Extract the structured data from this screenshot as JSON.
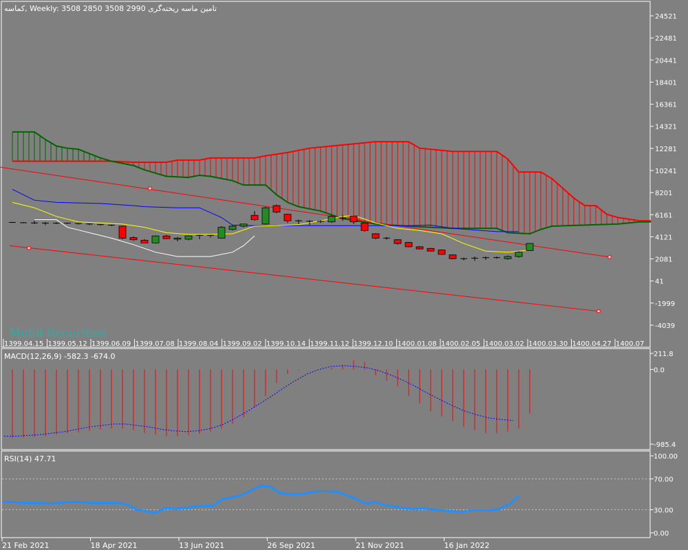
{
  "header": {
    "symbol": "کماسه",
    "timeframe": "Weekly:",
    "ohlc": "3508 2850 3508 2990",
    "company": "تامین ماسه ریخته‌گری"
  },
  "watermark": "Mofid Securities",
  "colors": {
    "background": "#808080",
    "grid": "#ffffff",
    "bull": "#228b22",
    "bear": "#ff0000",
    "cloud_a": "#ff0000",
    "cloud_b": "#006400",
    "tenkan": "#ffff00",
    "kijun": "#0000ff",
    "chikou": "#ffffff",
    "channel": "#ff0000",
    "macd_hist": "#ff0000",
    "macd_signal": "#0000ff",
    "rsi": "#1e90ff"
  },
  "chart_data": [
    {
      "type": "candlestick",
      "y_ticks": [
        "24521",
        "22481",
        "20441",
        "18401",
        "16361",
        "14321",
        "12281",
        "10241",
        "8201",
        "6161",
        "4121",
        "2081",
        "41",
        "-1999",
        "-4039"
      ],
      "ylim": [
        -5000,
        25500
      ],
      "x_ticks": [
        "1399.04.15",
        "1399.05.12",
        "1399.06.09",
        "1399.07.08",
        "1399.08.04",
        "1399.09.02",
        "1399.10.14",
        "1399.11.12",
        "1399.12.10",
        "1400.01.08",
        "1400.02.05",
        "1400.03.02",
        "1400.03.30",
        "1400.04.27",
        "1400.07"
      ],
      "candles": [
        {
          "o": 5450,
          "h": 5500,
          "l": 5400,
          "c": 5450
        },
        {
          "o": 5420,
          "h": 5480,
          "l": 5380,
          "c": 5420
        },
        {
          "o": 5400,
          "h": 5600,
          "l": 5300,
          "c": 5350
        },
        {
          "o": 5300,
          "h": 5500,
          "l": 5200,
          "c": 5380
        },
        {
          "o": 5380,
          "h": 5450,
          "l": 5300,
          "c": 5380
        },
        {
          "o": 5380,
          "h": 5420,
          "l": 5300,
          "c": 5350
        },
        {
          "o": 5350,
          "h": 5400,
          "l": 5250,
          "c": 5300
        },
        {
          "o": 5300,
          "h": 5350,
          "l": 5200,
          "c": 5250
        },
        {
          "o": 5250,
          "h": 5300,
          "l": 5150,
          "c": 5200
        },
        {
          "o": 5200,
          "h": 5250,
          "l": 5100,
          "c": 5150
        },
        {
          "o": 5100,
          "h": 5150,
          "l": 3900,
          "c": 4000
        },
        {
          "o": 4050,
          "h": 4150,
          "l": 3750,
          "c": 3850
        },
        {
          "o": 3800,
          "h": 3900,
          "l": 3500,
          "c": 3550
        },
        {
          "o": 3550,
          "h": 4250,
          "l": 3500,
          "c": 4200
        },
        {
          "o": 4200,
          "h": 4300,
          "l": 3900,
          "c": 3950
        },
        {
          "o": 3900,
          "h": 4100,
          "l": 3700,
          "c": 4000
        },
        {
          "o": 3900,
          "h": 4250,
          "l": 3800,
          "c": 4200
        },
        {
          "o": 4200,
          "h": 4300,
          "l": 3900,
          "c": 4250
        },
        {
          "o": 4250,
          "h": 4300,
          "l": 4050,
          "c": 4200
        },
        {
          "o": 4000,
          "h": 5100,
          "l": 3950,
          "c": 5000
        },
        {
          "o": 4800,
          "h": 5200,
          "l": 4700,
          "c": 5100
        },
        {
          "o": 5100,
          "h": 5300,
          "l": 5000,
          "c": 5300
        },
        {
          "o": 6100,
          "h": 6500,
          "l": 5600,
          "c": 5700
        },
        {
          "o": 5300,
          "h": 6900,
          "l": 5250,
          "c": 6800
        },
        {
          "o": 7000,
          "h": 7100,
          "l": 6300,
          "c": 6400
        },
        {
          "o": 6200,
          "h": 6250,
          "l": 5400,
          "c": 5600
        },
        {
          "o": 5600,
          "h": 5700,
          "l": 5300,
          "c": 5550
        },
        {
          "o": 5550,
          "h": 5650,
          "l": 5200,
          "c": 5500
        },
        {
          "o": 5550,
          "h": 5650,
          "l": 5400,
          "c": 5550
        },
        {
          "o": 5500,
          "h": 6100,
          "l": 5400,
          "c": 6000
        },
        {
          "o": 5850,
          "h": 6150,
          "l": 5600,
          "c": 5850
        },
        {
          "o": 6050,
          "h": 6150,
          "l": 5300,
          "c": 5500
        },
        {
          "o": 5400,
          "h": 5450,
          "l": 4600,
          "c": 4700
        },
        {
          "o": 4400,
          "h": 4450,
          "l": 3900,
          "c": 4000
        },
        {
          "o": 4000,
          "h": 4100,
          "l": 3850,
          "c": 3950
        },
        {
          "o": 3850,
          "h": 3900,
          "l": 3400,
          "c": 3500
        },
        {
          "o": 3600,
          "h": 3650,
          "l": 3150,
          "c": 3200
        },
        {
          "o": 3200,
          "h": 3250,
          "l": 2950,
          "c": 3000
        },
        {
          "o": 3050,
          "h": 3100,
          "l": 2750,
          "c": 2800
        },
        {
          "o": 2900,
          "h": 2950,
          "l": 2450,
          "c": 2500
        },
        {
          "o": 2450,
          "h": 2500,
          "l": 2050,
          "c": 2100
        },
        {
          "o": 2100,
          "h": 2200,
          "l": 1950,
          "c": 2050
        },
        {
          "o": 2100,
          "h": 2300,
          "l": 1900,
          "c": 2150
        },
        {
          "o": 2150,
          "h": 2300,
          "l": 2000,
          "c": 2200
        },
        {
          "o": 2200,
          "h": 2300,
          "l": 2100,
          "c": 2200
        },
        {
          "o": 2100,
          "h": 2400,
          "l": 2000,
          "c": 2300
        },
        {
          "o": 2300,
          "h": 2800,
          "l": 2200,
          "c": 2700
        },
        {
          "o": 2850,
          "h": 3508,
          "l": 2850,
          "c": 3508
        }
      ],
      "tenkan": [
        [
          0,
          7300
        ],
        [
          2,
          6800
        ],
        [
          4,
          6000
        ],
        [
          6,
          5500
        ],
        [
          8,
          5400
        ],
        [
          10,
          5300
        ],
        [
          12,
          5000
        ],
        [
          14,
          4500
        ],
        [
          16,
          4350
        ],
        [
          18,
          4350
        ],
        [
          20,
          4400
        ],
        [
          22,
          5100
        ],
        [
          24,
          5150
        ],
        [
          26,
          5250
        ],
        [
          28,
          5600
        ],
        [
          30,
          6000
        ],
        [
          31,
          6100
        ],
        [
          33,
          5400
        ],
        [
          35,
          4900
        ],
        [
          37,
          4700
        ],
        [
          39,
          4400
        ],
        [
          41,
          3500
        ],
        [
          43,
          2800
        ],
        [
          45,
          2700
        ],
        [
          47,
          2900
        ]
      ],
      "kijun": [
        [
          0,
          8500
        ],
        [
          2,
          7500
        ],
        [
          4,
          7300
        ],
        [
          8,
          7200
        ],
        [
          11,
          7000
        ],
        [
          12,
          6900
        ],
        [
          15,
          6800
        ],
        [
          17,
          6800
        ],
        [
          19,
          5900
        ],
        [
          20,
          5200
        ],
        [
          22,
          5150
        ],
        [
          30,
          5150
        ],
        [
          33,
          5150
        ],
        [
          36,
          5150
        ],
        [
          38,
          5200
        ],
        [
          40,
          4900
        ],
        [
          44,
          4600
        ],
        [
          46,
          4600
        ]
      ],
      "chikou": [
        [
          2,
          5700
        ],
        [
          4,
          5700
        ],
        [
          5,
          5000
        ],
        [
          7,
          4500
        ],
        [
          9,
          4000
        ],
        [
          11,
          3400
        ],
        [
          13,
          2700
        ],
        [
          15,
          2300
        ],
        [
          18,
          2300
        ],
        [
          20,
          2700
        ],
        [
          21,
          3300
        ],
        [
          22,
          4200
        ]
      ],
      "span_a": [
        [
          0,
          11100
        ],
        [
          9,
          11100
        ],
        [
          11,
          11000
        ],
        [
          14,
          11000
        ],
        [
          15,
          11200
        ],
        [
          16,
          11200
        ],
        [
          17,
          11200
        ],
        [
          18,
          11400
        ],
        [
          22,
          11400
        ],
        [
          23,
          11600
        ],
        [
          25,
          11900
        ],
        [
          27,
          12300
        ],
        [
          29,
          12500
        ],
        [
          31,
          12700
        ],
        [
          33,
          12900
        ],
        [
          36,
          12900
        ],
        [
          37,
          12300
        ],
        [
          40,
          12000
        ],
        [
          44,
          12000
        ],
        [
          45,
          11300
        ],
        [
          46,
          10100
        ],
        [
          48,
          10100
        ],
        [
          49,
          9500
        ],
        [
          51,
          7700
        ],
        [
          52,
          7000
        ],
        [
          53,
          7000
        ],
        [
          54,
          6200
        ],
        [
          55,
          5900
        ],
        [
          57,
          5600
        ],
        [
          58,
          5600
        ]
      ],
      "span_b": [
        [
          0,
          13800
        ],
        [
          1,
          13800
        ],
        [
          2,
          13800
        ],
        [
          3,
          13100
        ],
        [
          4,
          12500
        ],
        [
          5,
          12300
        ],
        [
          6,
          12200
        ],
        [
          7,
          11800
        ],
        [
          8,
          11400
        ],
        [
          9,
          11100
        ],
        [
          11,
          10700
        ],
        [
          12,
          10300
        ],
        [
          13,
          10000
        ],
        [
          14,
          9700
        ],
        [
          16,
          9600
        ],
        [
          17,
          9800
        ],
        [
          18,
          9700
        ],
        [
          20,
          9300
        ],
        [
          21,
          8900
        ],
        [
          23,
          8900
        ],
        [
          24,
          8000
        ],
        [
          25,
          7300
        ],
        [
          26,
          6900
        ],
        [
          28,
          6500
        ],
        [
          30,
          5800
        ],
        [
          33,
          5300
        ],
        [
          36,
          5100
        ],
        [
          38,
          5000
        ],
        [
          40,
          4900
        ],
        [
          44,
          4900
        ],
        [
          45,
          4500
        ],
        [
          47,
          4400
        ],
        [
          48,
          4800
        ],
        [
          49,
          5100
        ],
        [
          52,
          5200
        ],
        [
          55,
          5300
        ],
        [
          57,
          5500
        ],
        [
          58,
          5500
        ]
      ],
      "channel": [
        {
          "from": [
            0,
            10550
          ],
          "to": [
            55,
            2250
          ]
        },
        {
          "from": [
            0,
            3300
          ],
          "to": [
            54,
            -2750
          ]
        }
      ]
    },
    {
      "type": "bar",
      "title": "MACD(12,26,9) -582.3 -674.0",
      "y_ticks": [
        "211.8",
        "0.0",
        "-985.4"
      ],
      "ylim": [
        -985.4,
        211.8
      ],
      "histogram": [
        -900,
        -900,
        -890,
        -880,
        -860,
        -840,
        -830,
        -810,
        -790,
        -780,
        -780,
        -800,
        -840,
        -860,
        -880,
        -880,
        -870,
        -850,
        -820,
        -780,
        -720,
        -630,
        -500,
        -350,
        -180,
        -60,
        -10,
        0,
        0,
        20,
        60,
        120,
        100,
        -80,
        -150,
        -220,
        -350,
        -450,
        -550,
        -620,
        -680,
        -760,
        -800,
        -840,
        -840,
        -820,
        -780,
        -582.3
      ],
      "signal": [
        -880,
        -880,
        -870,
        -860,
        -840,
        -820,
        -790,
        -760,
        -740,
        -720,
        -720,
        -740,
        -760,
        -790,
        -810,
        -820,
        -810,
        -780,
        -730,
        -650,
        -560,
        -460,
        -360,
        -250,
        -150,
        -60,
        0,
        40,
        50,
        40,
        20,
        -20,
        -80,
        -150,
        -230,
        -320,
        -400,
        -480,
        -550,
        -600,
        -640,
        -660,
        -674.0
      ]
    },
    {
      "type": "line",
      "title": "RSI(14) 47.71",
      "y_ticks": [
        "100.00",
        "70.00",
        "30.00",
        "0.00"
      ],
      "ylim": [
        0,
        100
      ],
      "levels": [
        70,
        30
      ],
      "x_ticks": [
        "21 Feb 2021",
        "18 Apr 2021",
        "13 Jun 2021",
        "26 Sep 2021",
        "21 Nov 2021",
        "16 Jan 2022"
      ],
      "values": [
        40,
        40,
        39,
        39,
        39,
        38,
        39,
        40,
        40,
        39,
        39,
        39,
        39,
        37,
        30,
        28,
        26,
        32,
        31,
        32,
        34,
        35,
        35,
        44,
        46,
        49,
        55,
        61,
        60,
        52,
        50,
        50,
        52,
        54,
        54,
        53,
        49,
        44,
        38,
        40,
        36,
        34,
        32,
        31,
        32,
        30,
        29,
        28,
        27,
        29,
        29,
        29,
        31,
        37,
        47.71
      ]
    }
  ]
}
